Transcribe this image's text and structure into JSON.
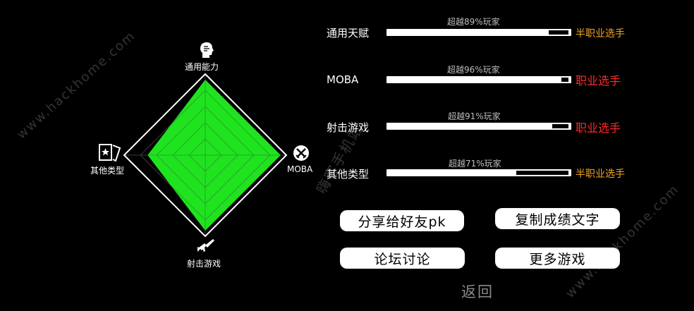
{
  "radar": {
    "axes": [
      {
        "key": "general",
        "label": "通用能力",
        "icon": "head-profile-icon",
        "value": 0.93
      },
      {
        "key": "moba",
        "label": "MOBA",
        "icon": "crossed-swords-icon",
        "value": 0.93
      },
      {
        "key": "shooter",
        "label": "射击游戏",
        "icon": "rifle-icon",
        "value": 0.93
      },
      {
        "key": "other",
        "label": "其他类型",
        "icon": "cards-star-icon",
        "value": 0.71
      }
    ],
    "fill_color": "#1fe31f",
    "grid_color": "#3a3a3a",
    "outline_color": "#ffffff"
  },
  "skills": [
    {
      "label": "通用天赋",
      "caption": "超越89%玩家",
      "percent": 89,
      "rank": "半职业选手",
      "rank_color": "#f5a623"
    },
    {
      "label": "MOBA",
      "caption": "超越96%玩家",
      "percent": 96,
      "rank": "职业选手",
      "rank_color": "#ff2a2a"
    },
    {
      "label": "射击游戏",
      "caption": "超越91%玩家",
      "percent": 91,
      "rank": "职业选手",
      "rank_color": "#ff2a2a"
    },
    {
      "label": "其他类型",
      "caption": "超越71%玩家",
      "percent": 71,
      "rank": "半职业选手",
      "rank_color": "#f5a623"
    }
  ],
  "buttons": {
    "share": "分享给好友pk",
    "copy": "复制成绩文字",
    "forum": "论坛讨论",
    "more": "更多游戏"
  },
  "back": "返回",
  "watermarks": [
    "www.hackhome.com",
    "嗨客手机站",
    "www.hackhome.com"
  ]
}
